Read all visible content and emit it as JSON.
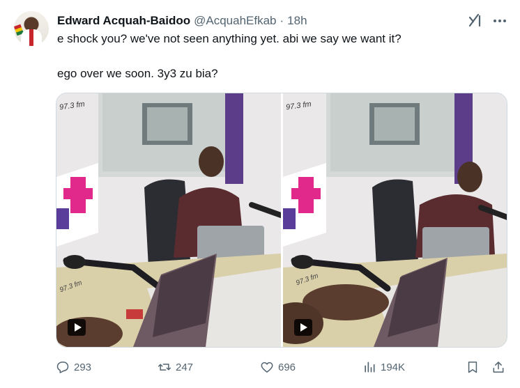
{
  "tweet": {
    "author_name": "Edward Acquah-Baidoo",
    "handle": "@AcquahEfkab",
    "separator": "·",
    "time": "18h",
    "text_line1": "e shock you? we've not seen anything yet. abi we say we want it?",
    "text_line2": "ego over we soon. 3y3 zu bia?"
  },
  "media": {
    "frames": [
      {
        "station_logo": "97.3 fm",
        "desk_sticker": "97.3 fm"
      },
      {
        "station_logo": "97.3 fm",
        "desk_sticker": "97.3 fm"
      }
    ]
  },
  "actions": {
    "replies": "293",
    "retweets": "247",
    "likes": "696",
    "views": "194K"
  },
  "icons": {
    "grok": "grok-icon",
    "more": "more-icon",
    "reply": "reply-icon",
    "retweet": "retweet-icon",
    "like": "heart-icon",
    "views": "views-icon",
    "bookmark": "bookmark-icon",
    "share": "share-icon",
    "play": "play-icon"
  },
  "colors": {
    "text": "#0f1419",
    "secondary": "#536471",
    "border": "#cfd9de"
  }
}
